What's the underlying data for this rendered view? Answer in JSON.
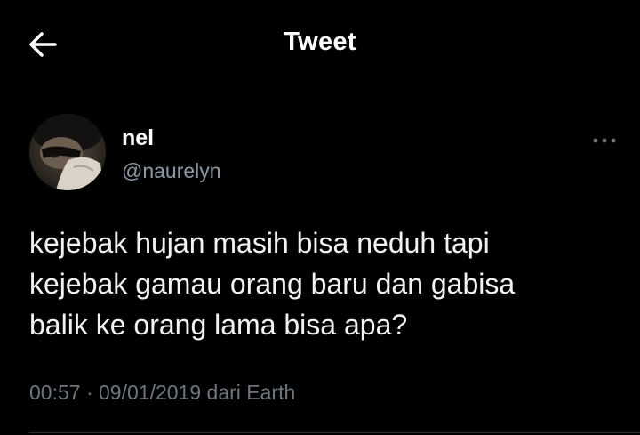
{
  "header": {
    "title": "Tweet",
    "back_icon": "arrow-left-icon"
  },
  "author": {
    "display_name": "nel",
    "handle": "@naurelyn",
    "avatar": "profile-photo"
  },
  "tweet": {
    "text": "kejebak hujan masih bisa neduh tapi\nkejebak gamau orang baru dan gabisa\nbalik ke orang lama bisa apa?",
    "time": "00:57",
    "separator": "·",
    "date": "09/01/2019",
    "source": "dari Earth"
  },
  "more_icon": "more-horizontal-icon",
  "colors": {
    "background": "#000000",
    "primary_text": "#ffffff",
    "secondary_text": "#8b98a5",
    "meta_text": "#6e767d"
  }
}
